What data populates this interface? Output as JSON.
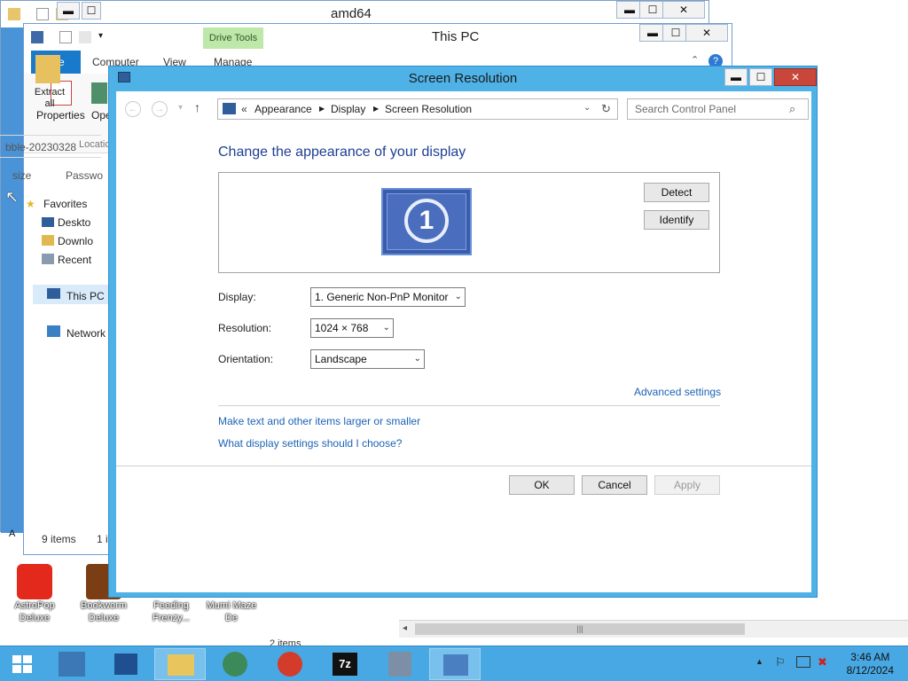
{
  "win_amd64": {
    "title": "amd64",
    "min": "▬",
    "max": "☐",
    "close": "✕"
  },
  "win_thispc": {
    "title": "This PC",
    "drive_tools": "Drive Tools",
    "tabs": {
      "file": "File",
      "computer": "Computer",
      "view": "View",
      "manage": "Manage"
    },
    "ribbon": {
      "properties": "Properties",
      "open": "Ope",
      "location": "Locatio"
    },
    "nav": {
      "favorites": "Favorites",
      "desktop": "Deskto",
      "downloads": "Downlo",
      "recent": "Recent",
      "this_pc": "This PC",
      "network": "Network"
    },
    "status": {
      "items": "9 items",
      "selected": "1 it"
    }
  },
  "win_right": {
    "extract_all": "Extract all",
    "filename": "bble-20230328",
    "col_size": "size",
    "col_password": "Passwo",
    "footer": "2 items"
  },
  "dialog": {
    "title": "Screen Resolution",
    "breadcrumb": {
      "sep": "«",
      "items": [
        "Appearance",
        "Display",
        "Screen Resolution"
      ]
    },
    "search_placeholder": "Search Control Panel",
    "heading": "Change the appearance of your display",
    "monitor_number": "1",
    "detect": "Detect",
    "identify": "Identify",
    "display_label": "Display:",
    "display_value": "1. Generic Non-PnP Monitor",
    "resolution_label": "Resolution:",
    "resolution_value": "1024 × 768",
    "orientation_label": "Orientation:",
    "orientation_value": "Landscape",
    "advanced": "Advanced settings",
    "link_text_size": "Make text and other items larger or smaller",
    "link_which": "What display settings should I choose?",
    "ok": "OK",
    "cancel": "Cancel",
    "apply": "Apply"
  },
  "desktop": {
    "icons": [
      "AstroPop Deluxe",
      "Bookworm Deluxe",
      "Feeding Frenzy...",
      "Mumi Maze De"
    ],
    "partial_a": "A"
  },
  "taskbar": {
    "time": "3:46 AM",
    "date": "8/12/2024"
  },
  "colors": {
    "accent": "#4fb2e6",
    "taskbar": "#48a8e3",
    "link": "#1b63b5",
    "heading": "#1e3f94",
    "file_tab": "#1979ca"
  }
}
